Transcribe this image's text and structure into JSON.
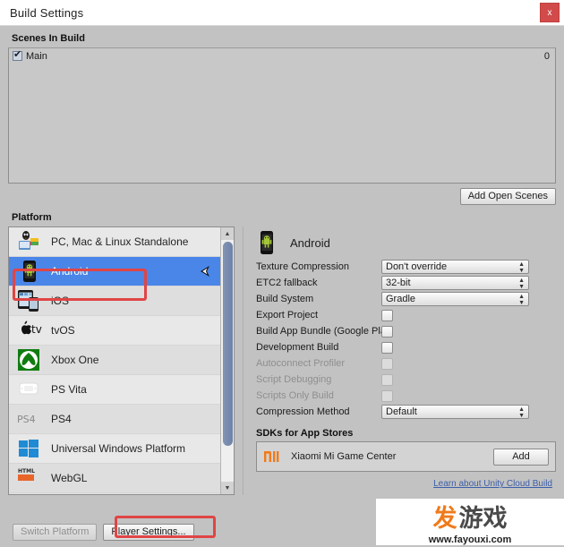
{
  "window": {
    "title": "Build Settings",
    "close_label": "x",
    "close_icon": "close-icon",
    "close_color": "#d24b4b"
  },
  "scenes": {
    "section_label": "Scenes In Build",
    "rows": [
      {
        "name": "Main",
        "index": "0",
        "checked": true
      }
    ],
    "add_open_scenes_label": "Add Open Scenes"
  },
  "platform": {
    "section_label": "Platform",
    "selected": "Android",
    "items": [
      {
        "label": "PC, Mac & Linux Standalone",
        "icon": "standalone-icon",
        "selected": false,
        "unity_mark": false
      },
      {
        "label": "Android",
        "icon": "android-icon",
        "selected": true,
        "unity_mark": true
      },
      {
        "label": "iOS",
        "icon": "ios-icon",
        "selected": false,
        "unity_mark": false
      },
      {
        "label": "tvOS",
        "icon": "tvos-icon",
        "selected": false,
        "unity_mark": false
      },
      {
        "label": "Xbox One",
        "icon": "xbox-icon",
        "selected": false,
        "unity_mark": false
      },
      {
        "label": "PS Vita",
        "icon": "psvita-icon",
        "selected": false,
        "unity_mark": false
      },
      {
        "label": "PS4",
        "icon": "ps4-icon",
        "selected": false,
        "unity_mark": false
      },
      {
        "label": "Universal Windows Platform",
        "icon": "uwp-icon",
        "selected": false,
        "unity_mark": false
      },
      {
        "label": "WebGL",
        "icon": "webgl-icon",
        "selected": false,
        "unity_mark": false
      }
    ],
    "scroll_up_glyph": "▲",
    "scroll_down_glyph": "▼"
  },
  "settings": {
    "header_title": "Android",
    "header_icon": "android-icon",
    "dropdowns": [
      {
        "label": "Texture Compression",
        "value": "Don't override"
      },
      {
        "label": "ETC2 fallback",
        "value": "32-bit"
      },
      {
        "label": "Build System",
        "value": "Gradle"
      }
    ],
    "checkboxes": [
      {
        "label": "Export Project",
        "checked": false,
        "disabled": false
      },
      {
        "label": "Build App Bundle (Google Pla",
        "checked": false,
        "disabled": false
      },
      {
        "label": "Development Build",
        "checked": false,
        "disabled": false
      },
      {
        "label": "Autoconnect Profiler",
        "checked": false,
        "disabled": true
      },
      {
        "label": "Script Debugging",
        "checked": false,
        "disabled": true
      },
      {
        "label": "Scripts Only Build",
        "checked": false,
        "disabled": true
      }
    ],
    "compression": {
      "label": "Compression Method",
      "value": "Default"
    }
  },
  "sdks": {
    "section_label": "SDKs for App Stores",
    "rows": [
      {
        "name": "Xiaomi Mi Game Center",
        "icon": "xiaomi-mi-icon",
        "button_label": "Add"
      }
    ]
  },
  "cloud_build": {
    "link_label": "Learn about Unity Cloud Build"
  },
  "bottom": {
    "switch_platform_label": "Switch Platform",
    "switch_platform_disabled": true,
    "player_settings_label": "Player Settings...",
    "build_label": ""
  },
  "annotations": {
    "highlight_color": "#e04545",
    "boxes": [
      "android-platform-row",
      "player-settings-button"
    ]
  },
  "watermark": {
    "cn_first": "发",
    "cn_rest": "游戏",
    "url": "www.fayouxi.com",
    "accent": "#f07a1a"
  }
}
